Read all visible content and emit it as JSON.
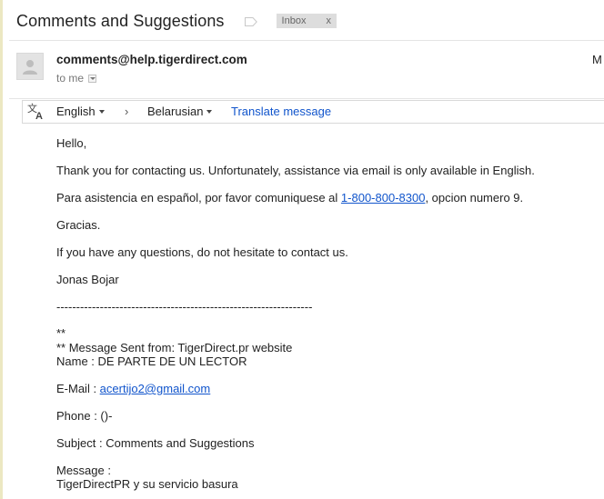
{
  "header": {
    "subject": "Comments and Suggestions",
    "label_chip": "Inbox",
    "label_chip_close": "x"
  },
  "message": {
    "sender": "comments@help.tigerdirect.com",
    "recipient_line": "to me",
    "cut_off_right": "M"
  },
  "translate_bar": {
    "source_language": "English",
    "arrow": "›",
    "target_language": "Belarusian",
    "action": "Translate message"
  },
  "body": {
    "greeting": "Hello,",
    "p1": "Thank you for contacting us. Unfortunately, assistance via email is only available in English.",
    "p2_before": "Para asistencia en español,  por favor comuniquese al ",
    "p2_phone": "1-800-800-8300",
    "p2_after": ", opcion numero 9.",
    "thanks": "Gracias.",
    "p3": "If you have any questions, do not hesitate to contact us.",
    "signature": "Jonas Bojar",
    "separator": "-----------------------------------------------------------------",
    "stars": "**",
    "sent_from": "** Message Sent from: TigerDirect.pr website",
    "name_line": "Name : DE PARTE DE UN LECTOR",
    "email_label": "E-Mail : ",
    "email_value": "acertijo2@gmail.com",
    "phone_line": "Phone : ()-",
    "subject_line": "Subject : Comments and Suggestions",
    "message_label": "Message :",
    "message_value": "TigerDirectPR y su servicio basura"
  },
  "colors": {
    "link": "#1155cc",
    "chip_bg": "#dddddd",
    "left_edge": "#ece8c2"
  }
}
